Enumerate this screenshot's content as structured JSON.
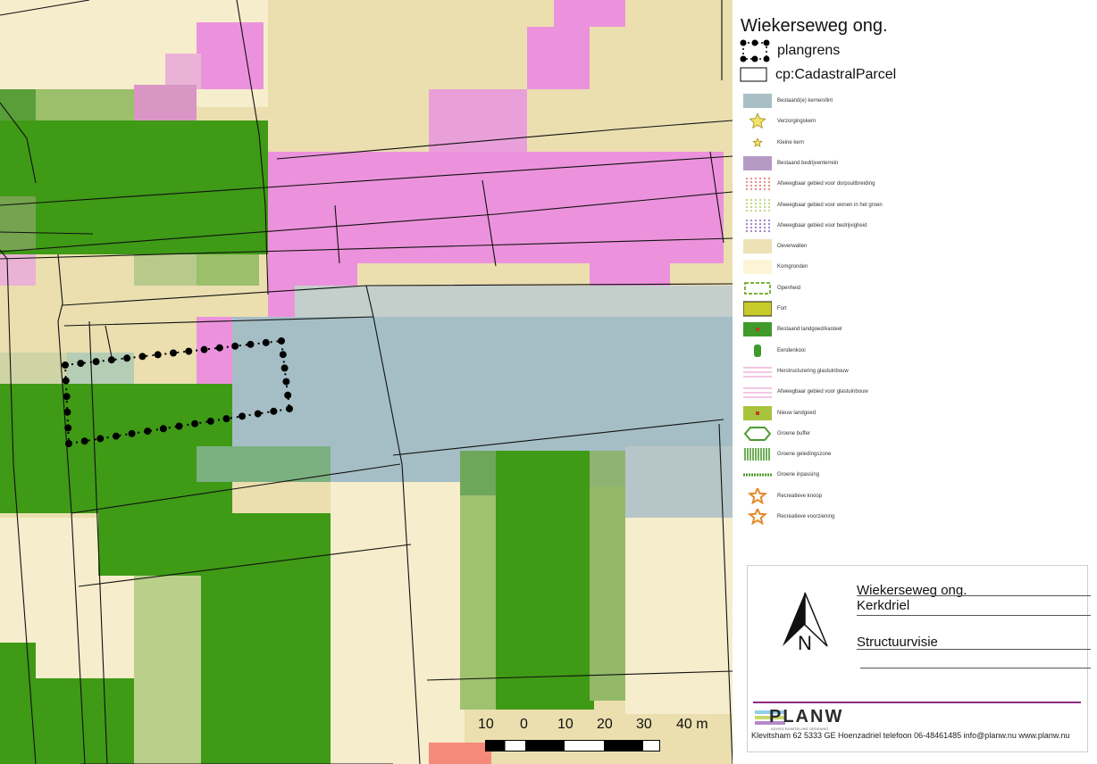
{
  "legend": {
    "title": "Wiekerseweg ong.",
    "items": [
      {
        "label": "plangrens",
        "symbol": "dotted-boundary"
      },
      {
        "label": "cp:CadastralParcel",
        "symbol": "empty-rectangle"
      }
    ]
  },
  "theme_legend": [
    {
      "label": "Bestaand(e) kernen/lint",
      "color": "#a9bfc6"
    },
    {
      "label": "Verzorgingskern",
      "color": "#f3e36a"
    },
    {
      "label": "Kleine kern",
      "color": "#f3e36a"
    },
    {
      "label": "Bestaand bedrijventerrein",
      "color": "#b69ac6"
    },
    {
      "label": "Afweegbaar gebied voor dorpsuitbreiding",
      "color": "#e9857a"
    },
    {
      "label": "Afweegbaar gebied voor wonen in het groen",
      "color": "#b9d67a"
    },
    {
      "label": "Afweegbaar gebied voor bedrijvigheid",
      "color": "#9a7cc8"
    },
    {
      "label": "Oeverwallen",
      "color": "#ece2b6"
    },
    {
      "label": "Komgronden",
      "color": "#fbf5d6"
    },
    {
      "label": "Openheid",
      "color": "#7fb33b"
    },
    {
      "label": "Fort",
      "color": "#c8c92a"
    },
    {
      "label": "Bestaand landgoed/kasteel",
      "color": "#3f9a2a"
    },
    {
      "label": "Eendenkooi",
      "color": "#3f9a2a"
    },
    {
      "label": "Herstructurering glastuinbouw",
      "color": "#e58fc4"
    },
    {
      "label": "Afweegbaar gebied voor glastuinbouw",
      "color": "#e58fc4"
    },
    {
      "label": "Nieuw landgoed",
      "color": "#a8c43c"
    },
    {
      "label": "Groene buffer",
      "color": "#4e9a30"
    },
    {
      "label": "Groene geledingszone",
      "color": "#4e9a30"
    },
    {
      "label": "Groene inpassing",
      "color": "#4e9a30"
    },
    {
      "label": "Recreatieve knoop",
      "color": "#e38a2a"
    },
    {
      "label": "Recreatieve voorziening",
      "color": "#e38a2a"
    }
  ],
  "titleblock": {
    "line1": "Wiekerseweg ong.",
    "line2": "Kerkdriel",
    "line3": "Structuurvisie",
    "north_label": "N",
    "logo": "PLANW",
    "logo_sub": "ADVIES  RUIMTELIJKE ORDENING",
    "footer": "Klevitsham 62  5333 GE Hoenzadriel  telefoon 06-48461485  info@planw.nu  www.planw.nu"
  },
  "scalebar": {
    "labels": [
      "10",
      "0",
      "10",
      "20",
      "30",
      "40 m"
    ]
  },
  "colors": {
    "oeverwallen": "#ebdfb0",
    "komgronden": "#f6edcc",
    "pink": "#ec92dc",
    "green": "#3f9a16",
    "blue_grey": "#a5bec6",
    "light_green": "#9cbc6a"
  }
}
